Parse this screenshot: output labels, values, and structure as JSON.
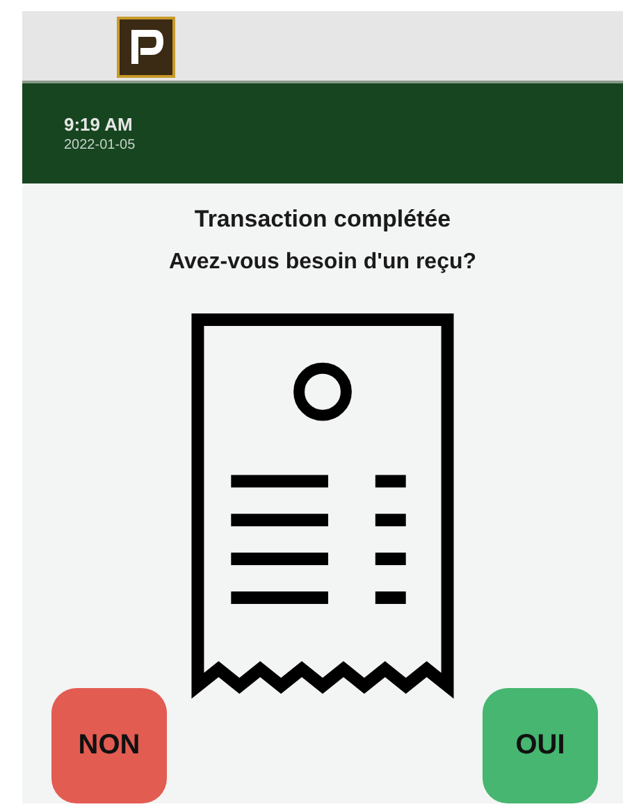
{
  "header": {
    "time": "9:19 AM",
    "date": "2022-01-05"
  },
  "title": "Transaction complétée",
  "question": "Avez-vous besoin d'un reçu?",
  "buttons": [
    {
      "label": "NON",
      "kind": "decline"
    },
    {
      "label": "OUI",
      "kind": "accept"
    }
  ]
}
